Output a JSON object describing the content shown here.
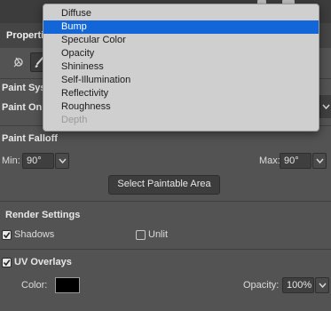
{
  "panel": {
    "title": "Properti",
    "icons": {
      "top_right": [
        "window-control-icon",
        "window-control-icon"
      ],
      "tool_1": "paint-target-icon",
      "tool_2": "brush-icon"
    }
  },
  "menu": {
    "items": [
      {
        "label": "Diffuse",
        "state": "normal"
      },
      {
        "label": "Bump",
        "state": "selected"
      },
      {
        "label": "Specular Color",
        "state": "normal"
      },
      {
        "label": "Opacity",
        "state": "normal"
      },
      {
        "label": "Shininess",
        "state": "normal"
      },
      {
        "label": "Self-Illumination",
        "state": "normal"
      },
      {
        "label": "Reflectivity",
        "state": "normal"
      },
      {
        "label": "Roughness",
        "state": "normal"
      },
      {
        "label": "Depth",
        "state": "disabled"
      }
    ]
  },
  "paint": {
    "system_label": "Paint Sys",
    "on_label": "Paint On:"
  },
  "falloff": {
    "title": "Paint Falloff",
    "min_label": "Min:",
    "min_value": "90°",
    "max_label": "Max:",
    "max_value": "90°",
    "select_button": "Select Paintable Area"
  },
  "render": {
    "title": "Render Settings",
    "shadows_label": "Shadows",
    "shadows_checked": true,
    "unlit_label": "Unlit",
    "unlit_checked": false
  },
  "uv": {
    "title": "UV Overlays",
    "checked": true,
    "color_label": "Color:",
    "color_value": "#000000",
    "opacity_label": "Opacity:",
    "opacity_value": "100%"
  },
  "colors": {
    "panel_bg": "#535353",
    "menu_bg": "#cfcfcf",
    "menu_selected": "#1366d8"
  }
}
